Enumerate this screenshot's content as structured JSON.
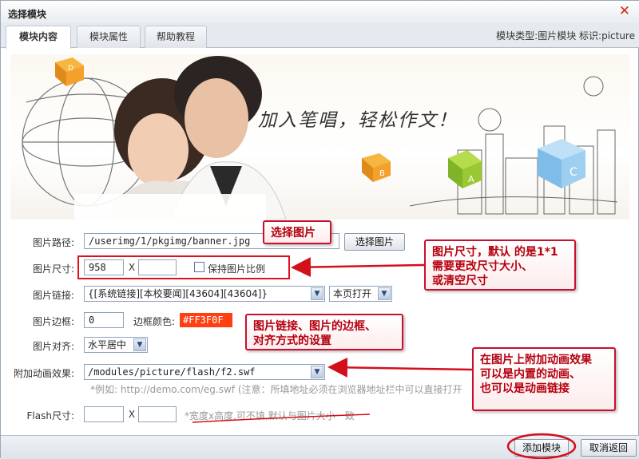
{
  "dialog": {
    "title": "选择模块",
    "close_glyph": "✕"
  },
  "tabs": [
    {
      "label": "模块内容",
      "active": true
    },
    {
      "label": "模块属性",
      "active": false
    },
    {
      "label": "帮助教程",
      "active": false
    }
  ],
  "module_info": "模块类型:图片模块 标识:picture",
  "banner": {
    "slogan": "加入笔唱，轻松作文！",
    "cube_letters": [
      "B",
      "A",
      "C",
      "D"
    ]
  },
  "form": {
    "image_path": {
      "label": "图片路径:",
      "value": "/userimg/1/pkgimg/banner.jpg",
      "button": "选择图片"
    },
    "image_size": {
      "label": "图片尺寸:",
      "width": "958",
      "x": "X",
      "height": "",
      "keep_ratio_label": "保持图片比例"
    },
    "image_link": {
      "label": "图片链接:",
      "value": "{[系统链接][本校要闻][43604][43604]}",
      "target": "本页打开"
    },
    "image_border": {
      "label": "图片边框:",
      "value": "0",
      "color_label": "边框颜色:",
      "color_value": "#FF3F0F"
    },
    "image_align": {
      "label": "图片对齐:",
      "value": "水平居中"
    },
    "animation": {
      "label": "附加动画效果:",
      "value": "/modules/picture/flash/f2.swf",
      "hint": "*例如: http://demo.com/eg.swf (注意：所填地址必须在浏览器地址栏中可以直接打开"
    },
    "flash_size": {
      "label": "Flash尺寸:",
      "x": "X",
      "width": "",
      "height": "",
      "hint": "*宽度x高度,可不填,默认与图片大小一致"
    }
  },
  "callouts": {
    "select_image": "选择图片",
    "size_note": [
      "图片尺寸，默认 的是1*1",
      "需要更改尺寸大小、",
      "或清空尺寸"
    ],
    "link_note": [
      "图片链接、图片的边框、",
      "对齐方式的设置"
    ],
    "animation_note": [
      "在图片上附加动画效果",
      "可以是内置的动画、",
      "也可以是动画链接"
    ]
  },
  "footer": {
    "add_button": "添加模块",
    "cancel_button": "取消返回"
  },
  "colors": {
    "accent_red": "#c8102e",
    "border_color_swatch": "#ff3f0f",
    "tab_bar": "#e6eaef"
  }
}
